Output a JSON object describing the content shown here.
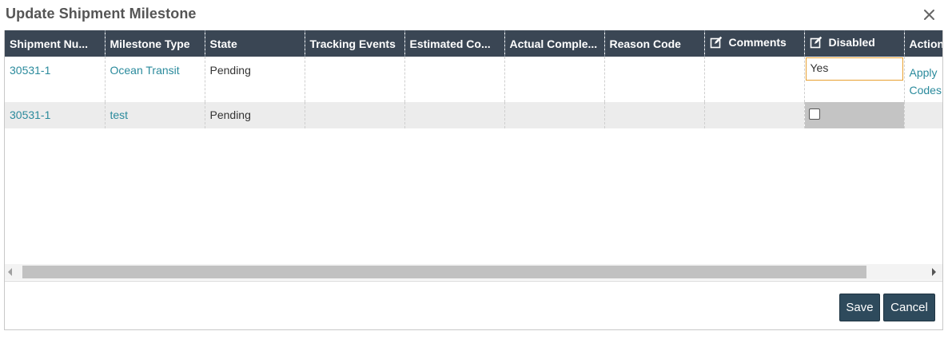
{
  "dialog": {
    "title": "Update Shipment Milestone",
    "close_icon": "close-icon"
  },
  "grid": {
    "columns": [
      {
        "label": "Shipment Nu..."
      },
      {
        "label": "Milestone Type"
      },
      {
        "label": "State"
      },
      {
        "label": "Tracking Events"
      },
      {
        "label": "Estimated Co..."
      },
      {
        "label": "Actual Comple..."
      },
      {
        "label": "Reason Code"
      },
      {
        "label": "Comments",
        "icon": "edit-icon"
      },
      {
        "label": "Disabled",
        "icon": "edit-icon"
      },
      {
        "label": "Action"
      }
    ],
    "rows": [
      {
        "shipment_number": "30531-1",
        "milestone_type": "Ocean Transit",
        "state": "Pending",
        "tracking_events": "",
        "estimated_completion": "",
        "actual_completion": "",
        "reason_code": "",
        "comments": "",
        "disabled_value": "Yes",
        "action_1": "Apply",
        "action_2": "Codes"
      },
      {
        "shipment_number": "30531-1",
        "milestone_type": "test",
        "state": "Pending",
        "tracking_events": "",
        "estimated_completion": "",
        "actual_completion": "",
        "reason_code": "",
        "comments": "",
        "disabled_checked": false
      }
    ]
  },
  "footer": {
    "save_label": "Save",
    "cancel_label": "Cancel"
  },
  "colors": {
    "header_bg": "#3a4654",
    "link": "#2a8a9c",
    "button_bg": "#2e4a5c",
    "focus_border": "#e8a030"
  }
}
